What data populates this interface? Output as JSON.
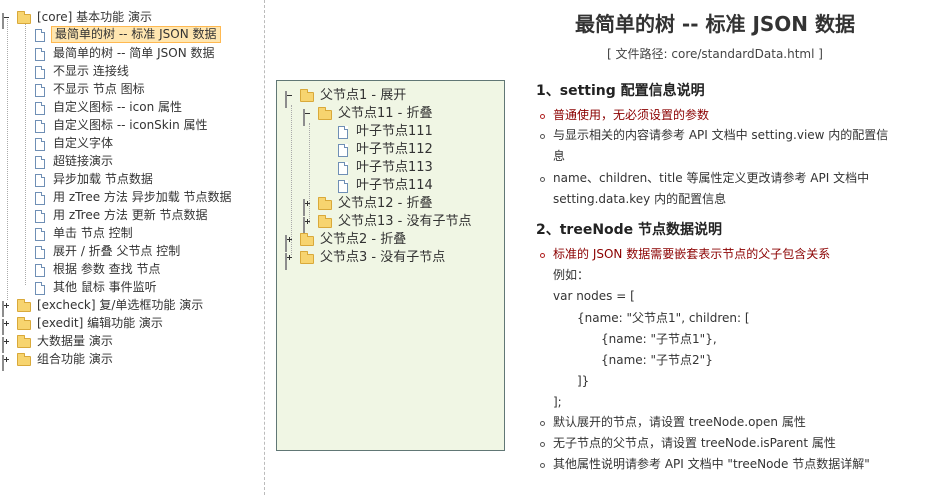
{
  "nav": {
    "items": [
      {
        "label": "[core] 基本功能 演示"
      },
      {
        "label": "最简单的树 -- 标准 JSON 数据"
      },
      {
        "label": "最简单的树 -- 简单 JSON 数据"
      },
      {
        "label": "不显示 连接线"
      },
      {
        "label": "不显示 节点 图标"
      },
      {
        "label": "自定义图标 -- icon 属性"
      },
      {
        "label": "自定义图标 -- iconSkin 属性"
      },
      {
        "label": "自定义字体"
      },
      {
        "label": "超链接演示"
      },
      {
        "label": "异步加载 节点数据"
      },
      {
        "label": "用 zTree 方法 异步加载 节点数据"
      },
      {
        "label": "用 zTree 方法 更新 节点数据"
      },
      {
        "label": "单击 节点 控制"
      },
      {
        "label": "展开 / 折叠 父节点 控制"
      },
      {
        "label": "根据 参数 查找 节点"
      },
      {
        "label": "其他 鼠标 事件监听"
      },
      {
        "label": "[excheck] 复/单选框功能 演示"
      },
      {
        "label": "[exedit] 编辑功能 演示"
      },
      {
        "label": "大数据量 演示"
      },
      {
        "label": "组合功能 演示"
      }
    ]
  },
  "demo_tree": {
    "nodes": [
      {
        "label": "父节点1 - 展开"
      },
      {
        "label": "父节点11 - 折叠"
      },
      {
        "label": "叶子节点111"
      },
      {
        "label": "叶子节点112"
      },
      {
        "label": "叶子节点113"
      },
      {
        "label": "叶子节点114"
      },
      {
        "label": "父节点12 - 折叠"
      },
      {
        "label": "父节点13 - 没有子节点"
      },
      {
        "label": "父节点2 - 折叠"
      },
      {
        "label": "父节点3 - 没有子节点"
      }
    ]
  },
  "content": {
    "title": "最简单的树 -- 标准 JSON 数据",
    "path": "[ 文件路径: core/standardData.html ]",
    "section1": {
      "heading": "1、setting 配置信息说明",
      "item1": "普通使用，无必须设置的参数",
      "item2_line1": "与显示相关的内容请参考 API 文档中 setting.view 内的配置信",
      "item2_line2": "息",
      "item3_line1": "name、children、title 等属性定义更改请参考 API 文档中",
      "item3_line2": "setting.data.key 内的配置信息"
    },
    "section2": {
      "heading": "2、treeNode 节点数据说明",
      "item1": "标准的 JSON 数据需要嵌套表示节点的父子包含关系",
      "example_label": "例如：",
      "code": [
        "var nodes = [",
        "{name: \"父节点1\", children: [",
        "{name: \"子节点1\"},",
        "{name: \"子节点2\"}",
        "]}",
        "];"
      ],
      "item2": "默认展开的节点，请设置 treeNode.open 属性",
      "item3": "无子节点的父节点，请设置 treeNode.isParent 属性",
      "item4": "其他属性说明请参考 API 文档中 \"treeNode 节点数据详解\""
    }
  }
}
